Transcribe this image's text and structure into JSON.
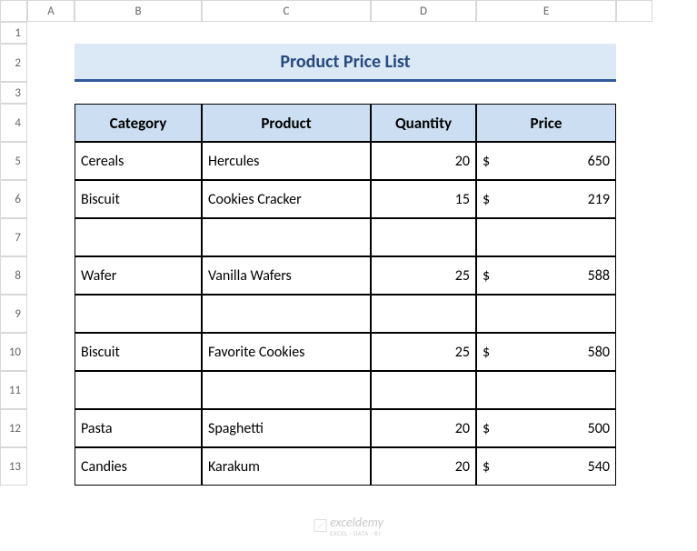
{
  "columns": [
    "A",
    "B",
    "C",
    "D",
    "E"
  ],
  "rows": [
    "1",
    "2",
    "3",
    "4",
    "5",
    "6",
    "7",
    "8",
    "9",
    "10",
    "11",
    "12",
    "13"
  ],
  "title": "Product Price List",
  "headers": {
    "category": "Category",
    "product": "Product",
    "quantity": "Quantity",
    "price": "Price"
  },
  "currency": "$",
  "data": [
    {
      "category": "Cereals",
      "product": "Hercules",
      "quantity": "20",
      "price": "650"
    },
    {
      "category": "Biscuit",
      "product": "Cookies Cracker",
      "quantity": "15",
      "price": "219"
    },
    {
      "category": "",
      "product": "",
      "quantity": "",
      "price": ""
    },
    {
      "category": "Wafer",
      "product": "Vanilla Wafers",
      "quantity": "25",
      "price": "588"
    },
    {
      "category": "",
      "product": "",
      "quantity": "",
      "price": ""
    },
    {
      "category": "Biscuit",
      "product": "Favorite Cookies",
      "quantity": "25",
      "price": "580"
    },
    {
      "category": "",
      "product": "",
      "quantity": "",
      "price": ""
    },
    {
      "category": "Pasta",
      "product": "Spaghetti",
      "quantity": "20",
      "price": "500"
    },
    {
      "category": "Candies",
      "product": "Karakum",
      "quantity": "20",
      "price": "540"
    }
  ],
  "watermark": {
    "brand": "exceldemy",
    "tag": "EXCEL · DATA · BI"
  },
  "chart_data": {
    "type": "table",
    "title": "Product Price List",
    "columns": [
      "Category",
      "Product",
      "Quantity",
      "Price"
    ],
    "rows": [
      [
        "Cereals",
        "Hercules",
        20,
        650
      ],
      [
        "Biscuit",
        "Cookies Cracker",
        15,
        219
      ],
      [
        "Wafer",
        "Vanilla Wafers",
        25,
        588
      ],
      [
        "Biscuit",
        "Favorite Cookies",
        25,
        580
      ],
      [
        "Pasta",
        "Spaghetti",
        20,
        500
      ],
      [
        "Candies",
        "Karakum",
        20,
        540
      ]
    ],
    "currency": "USD"
  }
}
